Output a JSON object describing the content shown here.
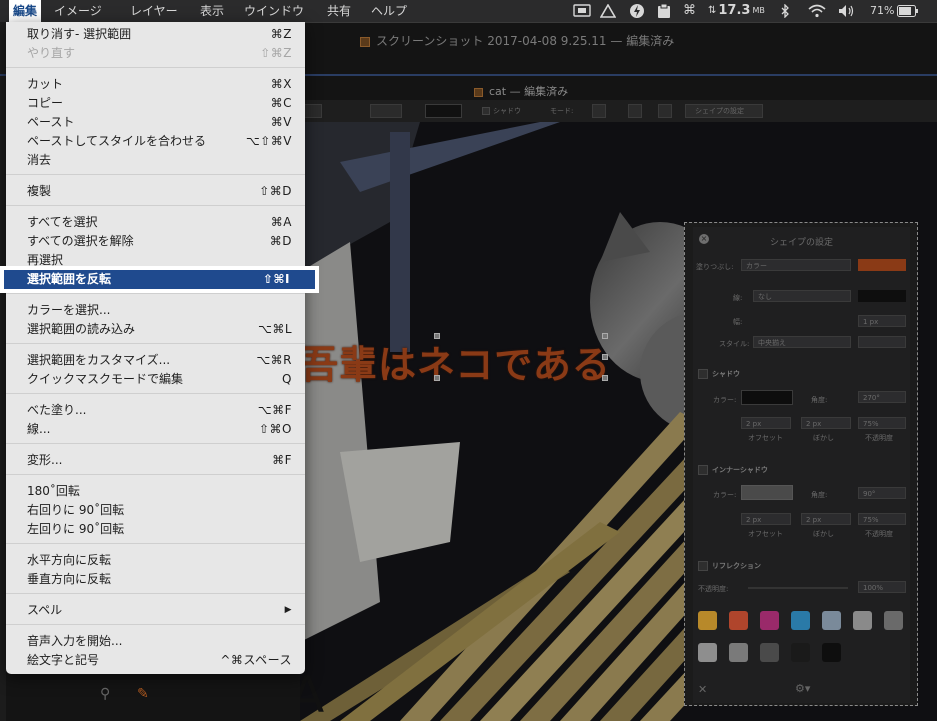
{
  "menubar": {
    "items": [
      "編集",
      "イメージ",
      "レイヤー",
      "表示",
      "ウインドウ",
      "共有",
      "ヘルプ"
    ],
    "status": {
      "network": "17.3",
      "network_unit": "MB",
      "battery": "71%"
    }
  },
  "document": {
    "title": "スクリーンショット 2017-04-08 9.25.11 — 編集済み",
    "subtitle": "cat — 編集済み",
    "caption_text": "吾輩はネコである"
  },
  "toolbar": {
    "shadow_label": "シャドウ",
    "mode_label": "モード:",
    "shape_settings_button": "シェイプの設定"
  },
  "shape_panel": {
    "title": "シェイプの設定",
    "fill_label": "塗りつぶし:",
    "fill_value": "カラー",
    "fill_color": "#d4561f",
    "border_label": "線:",
    "border_value": "なし",
    "width_label": "幅:",
    "width_value": "1 px",
    "style_label": "スタイル:",
    "style_value": "中央揃え",
    "shadow": {
      "section": "シャドウ",
      "color_label": "カラー:",
      "angle_label": "角度:",
      "angle_value": "270°",
      "offset_value": "2 px",
      "blur_value": "2 px",
      "opacity_value": "75%",
      "offset_label": "オフセット",
      "blur_label": "ぼかし",
      "opacity_label": "不透明度"
    },
    "inner_shadow": {
      "section": "インナーシャドウ",
      "color_label": "カラー:",
      "angle_label": "角度:",
      "angle_value": "90°",
      "offset_value": "2 px",
      "blur_value": "2 px",
      "opacity_value": "75%",
      "offset_label": "オフセット",
      "blur_label": "ぼかし",
      "opacity_label": "不透明度"
    },
    "reflection": {
      "section": "リフレクション",
      "opacity_label": "不透明度:",
      "opacity_value": "100%"
    },
    "swatches_row1": [
      "#b8892a",
      "#b0452c",
      "#9a2a6a",
      "#2a7aa8",
      "#7a8a9a",
      "#8a8a8a",
      "#6a6a6a"
    ],
    "swatches_row2": [
      "#8e8e8e",
      "#7a7a7a",
      "#4a4a4a",
      "#1a1a1a",
      "#0e0e0e"
    ]
  },
  "edit_menu": {
    "items": [
      {
        "label": "取り消す- 選択範囲",
        "shortcut": "⌘Z",
        "disabled": false
      },
      {
        "label": "やり直す",
        "shortcut": "⇧⌘Z",
        "disabled": true
      },
      {
        "label": "カット",
        "shortcut": "⌘X",
        "disabled": false
      },
      {
        "label": "コピー",
        "shortcut": "⌘C",
        "disabled": false
      },
      {
        "label": "ペースト",
        "shortcut": "⌘V",
        "disabled": false
      },
      {
        "label": "ペーストしてスタイルを合わせる",
        "shortcut": "⌥⇧⌘V",
        "disabled": false
      },
      {
        "label": "消去",
        "shortcut": "",
        "disabled": false
      },
      {
        "label": "複製",
        "shortcut": "⇧⌘D",
        "disabled": false
      },
      {
        "label": "すべてを選択",
        "shortcut": "⌘A",
        "disabled": false
      },
      {
        "label": "すべての選択を解除",
        "shortcut": "⌘D",
        "disabled": false
      },
      {
        "label": "再選択",
        "shortcut": "",
        "disabled": false
      },
      {
        "label": "選択範囲を反転",
        "shortcut": "⇧⌘I",
        "disabled": false
      },
      {
        "label": "カラーを選択...",
        "shortcut": "",
        "disabled": false
      },
      {
        "label": "選択範囲の読み込み",
        "shortcut": "⌥⌘L",
        "disabled": false
      },
      {
        "label": "選択範囲をカスタマイズ...",
        "shortcut": "⌥⌘R",
        "disabled": false
      },
      {
        "label": "クイックマスクモードで編集",
        "shortcut": "Q",
        "disabled": false
      },
      {
        "label": "べた塗り...",
        "shortcut": "⌥⌘F",
        "disabled": false
      },
      {
        "label": "線...",
        "shortcut": "⇧⌘O",
        "disabled": false
      },
      {
        "label": "変形...",
        "shortcut": "⌘F",
        "disabled": false
      },
      {
        "label": "180˚回転",
        "shortcut": "",
        "disabled": false
      },
      {
        "label": "右回りに 90˚回転",
        "shortcut": "",
        "disabled": false
      },
      {
        "label": "左回りに 90˚回転",
        "shortcut": "",
        "disabled": false
      },
      {
        "label": "水平方向に反転",
        "shortcut": "",
        "disabled": false
      },
      {
        "label": "垂直方向に反転",
        "shortcut": "",
        "disabled": false
      },
      {
        "label": "スペル",
        "shortcut": "▶",
        "disabled": false
      },
      {
        "label": "音声入力を開始...",
        "shortcut": "",
        "disabled": false
      },
      {
        "label": "絵文字と記号",
        "shortcut": "^⌘スペース",
        "disabled": false
      }
    ]
  }
}
